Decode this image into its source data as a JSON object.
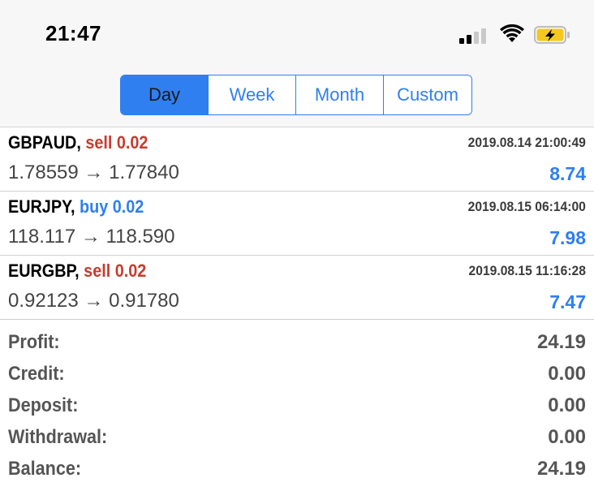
{
  "status_bar": {
    "time": "21:47",
    "icons": [
      "signal-icon",
      "wifi-icon",
      "battery-charging-icon"
    ]
  },
  "period_tabs": {
    "selected": "Day",
    "tabs": [
      {
        "label": "Day"
      },
      {
        "label": "Week"
      },
      {
        "label": "Month"
      },
      {
        "label": "Custom"
      }
    ]
  },
  "trades": [
    {
      "symbol": "GBPAUD,",
      "side": "sell 0.02",
      "side_type": "sell",
      "time": "2019.08.14 21:00:49",
      "prices": "1.78559 → 1.77840",
      "profit": "8.74"
    },
    {
      "symbol": "EURJPY,",
      "side": "buy 0.02",
      "side_type": "buy",
      "time": "2019.08.15 06:14:00",
      "prices": "118.117 → 118.590",
      "profit": "7.98"
    },
    {
      "symbol": "EURGBP,",
      "side": "sell 0.02",
      "side_type": "sell",
      "time": "2019.08.15 11:16:28",
      "prices": "0.92123 → 0.91780",
      "profit": "7.47"
    }
  ],
  "summary": {
    "profit_label": "Profit:",
    "profit_value": "24.19",
    "credit_label": "Credit:",
    "credit_value": "0.00",
    "deposit_label": "Deposit:",
    "deposit_value": "0.00",
    "withdrawal_label": "Withdrawal:",
    "withdrawal_value": "0.00",
    "balance_label": "Balance:",
    "balance_value": "24.19"
  },
  "colors": {
    "accent": "#2f7ff0",
    "sell": "#c83b2d",
    "buy": "#2f7ff0",
    "battery_charging": "#f4c81e"
  }
}
